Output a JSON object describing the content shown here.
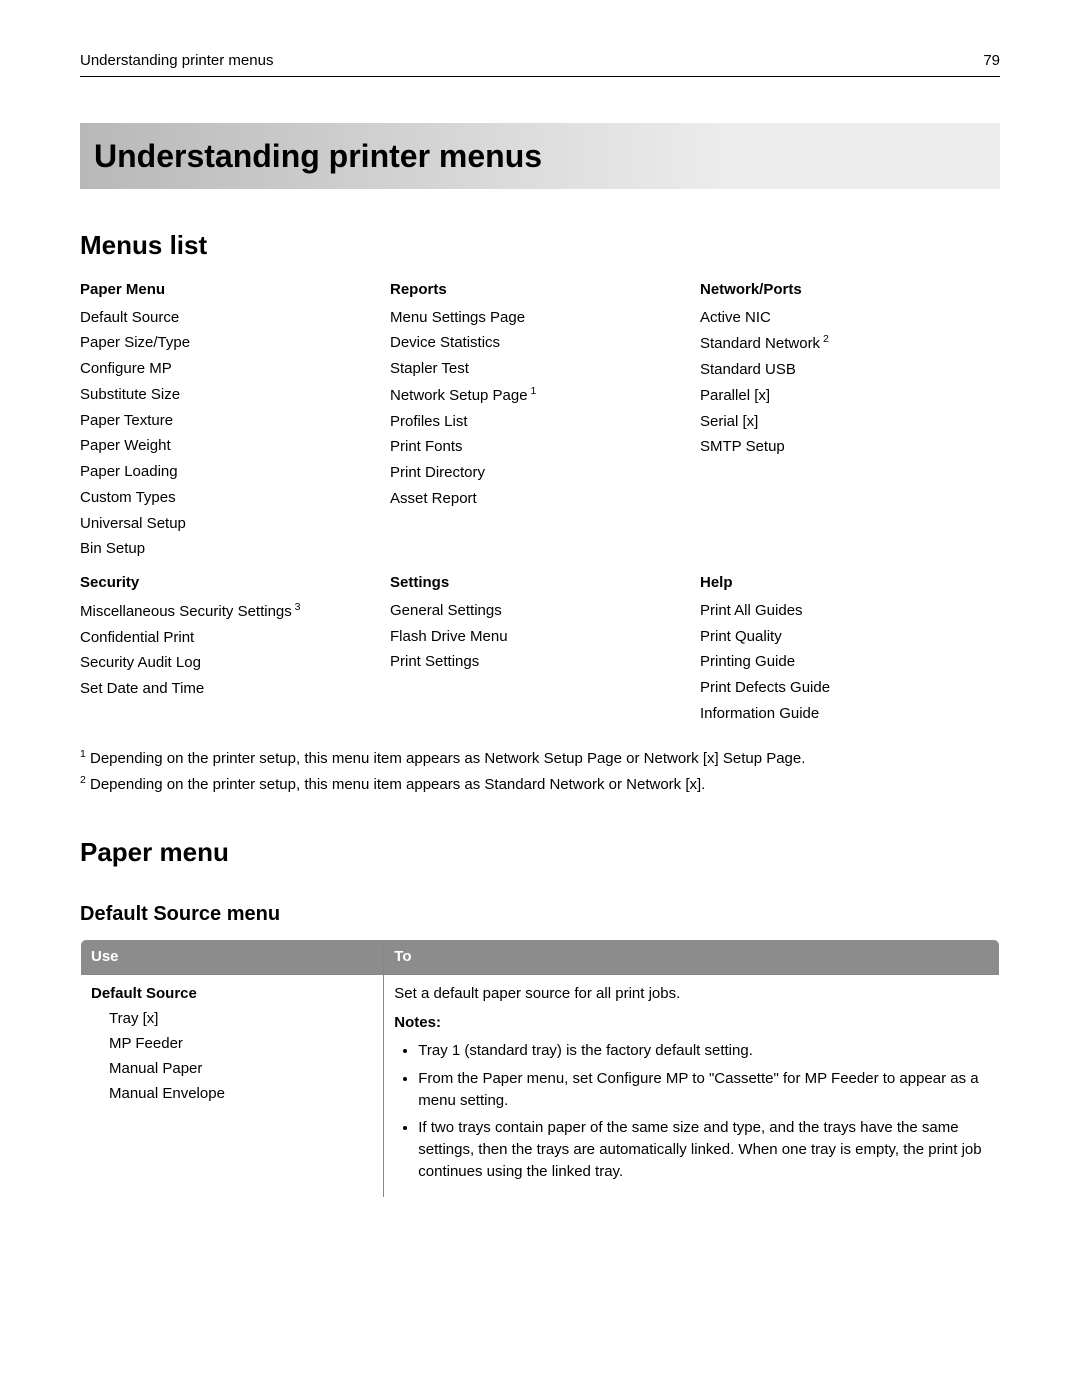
{
  "header": {
    "section": "Understanding printer menus",
    "page": "79"
  },
  "title": "Understanding printer menus",
  "menus_list_heading": "Menus list",
  "menu_groups": [
    {
      "heading": "Paper Menu",
      "items": [
        {
          "label": "Default Source"
        },
        {
          "label": "Paper Size/Type"
        },
        {
          "label": "Configure MP"
        },
        {
          "label": "Substitute Size"
        },
        {
          "label": "Paper Texture"
        },
        {
          "label": "Paper Weight"
        },
        {
          "label": "Paper Loading"
        },
        {
          "label": "Custom Types"
        },
        {
          "label": "Universal Setup"
        },
        {
          "label": "Bin Setup"
        }
      ]
    },
    {
      "heading": "Reports",
      "items": [
        {
          "label": "Menu Settings Page"
        },
        {
          "label": "Device Statistics"
        },
        {
          "label": "Stapler Test"
        },
        {
          "label": "Network Setup Page",
          "sup": "1"
        },
        {
          "label": "Profiles List"
        },
        {
          "label": "Print Fonts"
        },
        {
          "label": "Print Directory"
        },
        {
          "label": "Asset Report"
        }
      ]
    },
    {
      "heading": "Network/Ports",
      "items": [
        {
          "label": "Active NIC"
        },
        {
          "label": "Standard Network",
          "sup": "2"
        },
        {
          "label": "Standard USB"
        },
        {
          "label": "Parallel [x]"
        },
        {
          "label": "Serial [x]"
        },
        {
          "label": "SMTP Setup"
        }
      ]
    },
    {
      "heading": "Security",
      "items": [
        {
          "label": "Miscellaneous Security Settings",
          "sup": "3"
        },
        {
          "label": "Confidential Print"
        },
        {
          "label": "Security Audit Log"
        },
        {
          "label": "Set Date and Time"
        }
      ]
    },
    {
      "heading": "Settings",
      "items": [
        {
          "label": "General Settings"
        },
        {
          "label": "Flash Drive Menu"
        },
        {
          "label": "Print Settings"
        }
      ]
    },
    {
      "heading": "Help",
      "items": [
        {
          "label": "Print All Guides"
        },
        {
          "label": "Print Quality"
        },
        {
          "label": "Printing Guide"
        },
        {
          "label": "Print Defects Guide"
        },
        {
          "label": "Information Guide"
        }
      ]
    }
  ],
  "footnotes": [
    {
      "num": "1",
      "text": " Depending on the printer setup, this menu item appears as Network Setup Page or Network [x] Setup Page."
    },
    {
      "num": "2",
      "text": " Depending on the printer setup, this menu item appears as Standard Network or Network [x]."
    }
  ],
  "paper_menu_heading": "Paper menu",
  "default_source_heading": "Default Source menu",
  "table": {
    "head": {
      "use": "Use",
      "to": "To"
    },
    "row": {
      "name": "Default Source",
      "values": [
        "Tray [x]",
        "MP Feeder",
        "Manual Paper",
        "Manual Envelope"
      ],
      "desc": "Set a default paper source for all print jobs.",
      "notes_label": "Notes:",
      "notes": [
        "Tray 1 (standard tray) is the factory default setting.",
        "From the Paper menu, set Configure MP to \"Cassette\" for MP Feeder to appear as a menu setting.",
        "If two trays contain paper of the same size and type, and the trays have the same settings, then the trays are automatically linked. When one tray is empty, the print job continues using the linked tray."
      ]
    }
  }
}
